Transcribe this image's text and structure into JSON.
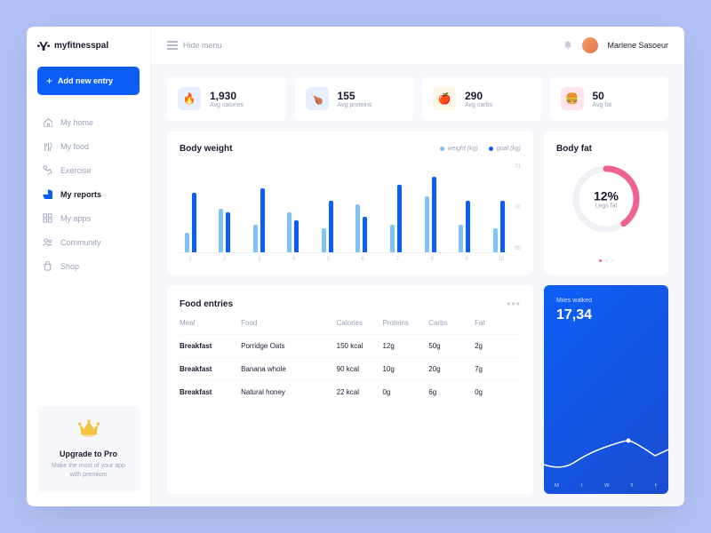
{
  "brand": "myfitnesspal",
  "header": {
    "hide_menu": "Hide menu",
    "username": "Marlene Sasoeur"
  },
  "sidebar": {
    "add_btn": "Add new entry",
    "items": [
      {
        "label": "My home",
        "icon": "home"
      },
      {
        "label": "My food",
        "icon": "food"
      },
      {
        "label": "Exercise",
        "icon": "exercise"
      },
      {
        "label": "My reports",
        "icon": "reports",
        "active": true
      },
      {
        "label": "My apps",
        "icon": "apps"
      },
      {
        "label": "Community",
        "icon": "community"
      },
      {
        "label": "Shop",
        "icon": "shop"
      }
    ],
    "promo": {
      "title": "Upgrade to Pro",
      "sub": "Make the most of your app with premium"
    }
  },
  "stats": [
    {
      "value": "1,930",
      "label": "Avg calories",
      "icon": "flame",
      "cls": "blue"
    },
    {
      "value": "155",
      "label": "Avg proteins",
      "icon": "drumstick",
      "cls": "lblue"
    },
    {
      "value": "290",
      "label": "Avg carbs",
      "icon": "apple",
      "cls": "yellow"
    },
    {
      "value": "50",
      "label": "Avg fat",
      "icon": "burger",
      "cls": "pink"
    }
  ],
  "chart": {
    "title": "Body weight",
    "legend": {
      "weight": "weight (kg)",
      "goal": "goal (kg)"
    },
    "y": [
      "71",
      "70",
      "69"
    ]
  },
  "chart_data": {
    "type": "bar",
    "title": "Body weight",
    "categories": [
      "1",
      "2",
      "3",
      "4",
      "5",
      "6",
      "7",
      "8",
      "9",
      "10"
    ],
    "series": [
      {
        "name": "weight (kg)",
        "values": [
          69.5,
          70.1,
          69.7,
          70.0,
          69.6,
          70.2,
          69.7,
          70.4,
          69.7,
          69.6
        ]
      },
      {
        "name": "goal (kg)",
        "values": [
          70.5,
          70.0,
          70.6,
          69.8,
          70.3,
          69.9,
          70.7,
          70.9,
          70.3,
          70.3
        ]
      }
    ],
    "ylabel": "kg",
    "ylim": [
      69,
      71
    ]
  },
  "bodyfat": {
    "title": "Body fat",
    "value": "12%",
    "label": "Legs fat"
  },
  "entries": {
    "title": "Food entries",
    "cols": [
      "Meal",
      "Food",
      "Calories",
      "Proteins",
      "Carbs",
      "Fat"
    ],
    "rows": [
      {
        "meal": "Breakfast",
        "food": "Porridge Oats",
        "cal": "150 kcal",
        "pro": "12g",
        "carb": "50g",
        "fat": "2g"
      },
      {
        "meal": "Breakfast",
        "food": "Banana whole",
        "cal": "90 kcal",
        "pro": "10g",
        "carb": "20g",
        "fat": "7g"
      },
      {
        "meal": "Breakfast",
        "food": "Natural honey",
        "cal": "22 kcal",
        "pro": "0g",
        "carb": "6g",
        "fat": "0g"
      }
    ]
  },
  "miles": {
    "label": "Miles walked",
    "value": "17,34",
    "days": [
      "M",
      "T",
      "W",
      "T",
      "F"
    ]
  }
}
